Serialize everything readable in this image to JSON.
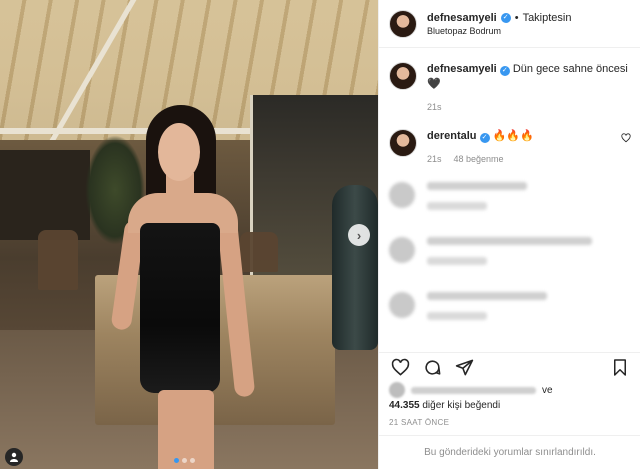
{
  "post": {
    "username": "defnesamyeli",
    "follow_separator": "•",
    "follow_state": "Takiptesin",
    "location": "Bluetopaz Bodrum",
    "caption_user": "defnesamyeli",
    "caption_text": "Dün gece sahne öncesi🖤",
    "caption_age": "21s"
  },
  "comments": [
    {
      "username": "derentalu",
      "text": "🔥🔥🔥",
      "age": "21s",
      "likes": "48 beğenme"
    }
  ],
  "blurred_comment_count": 3,
  "photo": {
    "carousel_dots": 3,
    "active_dot": 0,
    "next_arrow": "›",
    "user_tag_icon": "person-icon"
  },
  "actions": {
    "like_icon": "heart-icon",
    "comment_icon": "comment-icon",
    "share_icon": "send-icon",
    "save_icon": "bookmark-icon"
  },
  "likes": {
    "suffix_1": "ve",
    "count": "44.355",
    "suffix_2": "diğer kişi beğendi"
  },
  "timestamp": "21 SAAT ÖNCE",
  "restricted_notice": "Bu gönderideki yorumlar sınırlandırıldı.",
  "colors": {
    "verified": "#3897f0",
    "muted": "#8e8e8e",
    "border": "#efefef"
  }
}
